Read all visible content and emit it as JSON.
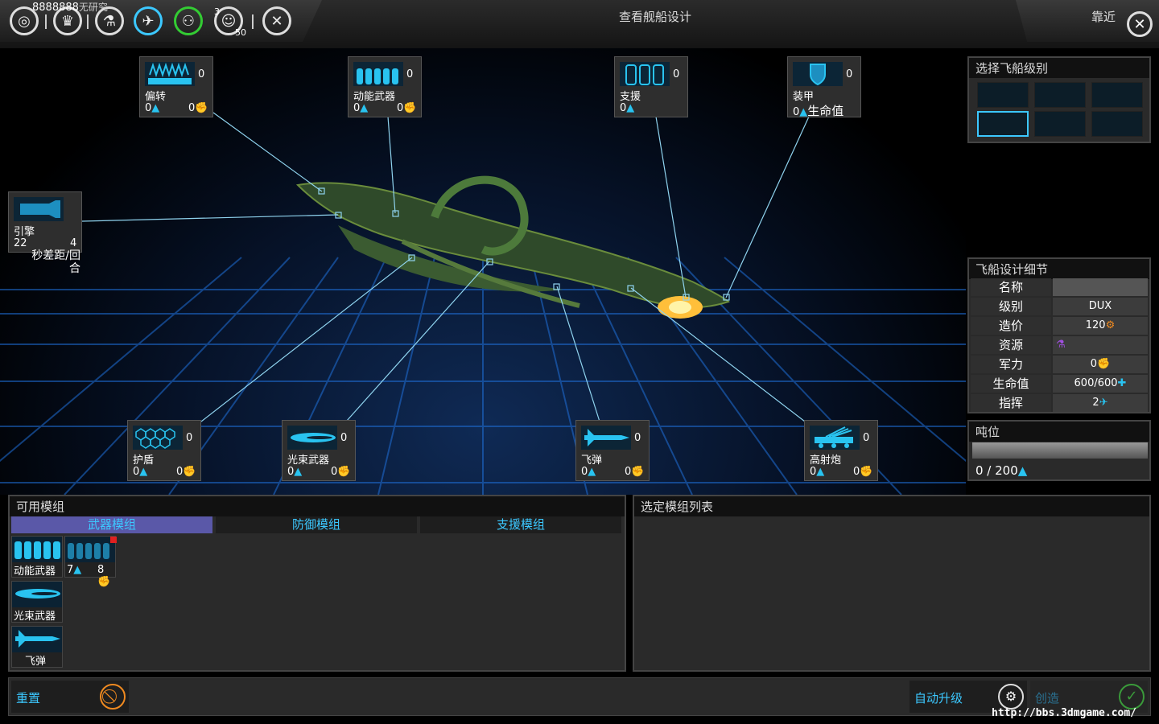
{
  "topbar": {
    "resource_text": "8888888",
    "research_text": "无研究",
    "badge_a": "3",
    "badge_b": "50",
    "title": "查看舰船设计",
    "zoom_label": "靠近",
    "icons": [
      "galaxy-icon",
      "empire-icon",
      "research-icon",
      "ship-design-icon",
      "diplomacy-icon",
      "population-icon",
      "settings-icon"
    ]
  },
  "slots": {
    "deflect": {
      "name": "偏转",
      "count": "0",
      "v1": "0",
      "v2": "0"
    },
    "kinetic": {
      "name": "动能武器",
      "count": "0",
      "v1": "0",
      "v2": "0"
    },
    "support": {
      "name": "支援",
      "count": "0",
      "v1": "0"
    },
    "armor": {
      "name": "装甲",
      "count": "0",
      "v1": "0",
      "v2": "生命值"
    },
    "engine": {
      "name": "引擎",
      "v1": "22",
      "v2": "4",
      "note": "秒差距/回合"
    },
    "shield": {
      "name": "护盾",
      "count": "0",
      "v1": "0",
      "v2": "0"
    },
    "beam": {
      "name": "光束武器",
      "count": "0",
      "v1": "0",
      "v2": "0"
    },
    "missile": {
      "name": "飞弹",
      "count": "0",
      "v1": "0",
      "v2": "0"
    },
    "artillery": {
      "name": "高射炮",
      "count": "0",
      "v1": "0",
      "v2": "0"
    }
  },
  "ship_class": {
    "title": "选择飞船级别"
  },
  "details": {
    "title": "飞船设计细节",
    "rows": [
      {
        "label": "名称",
        "value": ""
      },
      {
        "label": "级别",
        "value": "DUX"
      },
      {
        "label": "造价",
        "value": "120"
      },
      {
        "label": "资源",
        "value": ""
      },
      {
        "label": "军力",
        "value": "0"
      },
      {
        "label": "生命值",
        "value": "600/600"
      },
      {
        "label": "指挥",
        "value": "2"
      }
    ]
  },
  "tonnage": {
    "title": "吨位",
    "value": "0 / 200",
    "fill": 0
  },
  "modules": {
    "title": "可用模组",
    "tabs": [
      "武器模组",
      "防御模组",
      "支援模组"
    ],
    "items": [
      {
        "name": "动能武器"
      },
      {
        "name": "",
        "v1": "7",
        "v2": "8"
      },
      {
        "name": "光束武器"
      },
      {
        "name": "飞弹"
      }
    ]
  },
  "selected": {
    "title": "选定模组列表"
  },
  "bottom": {
    "reset": "重置",
    "auto": "自动升级",
    "create": "创造",
    "watermark": "http://bbs.3dmgame.com/"
  }
}
